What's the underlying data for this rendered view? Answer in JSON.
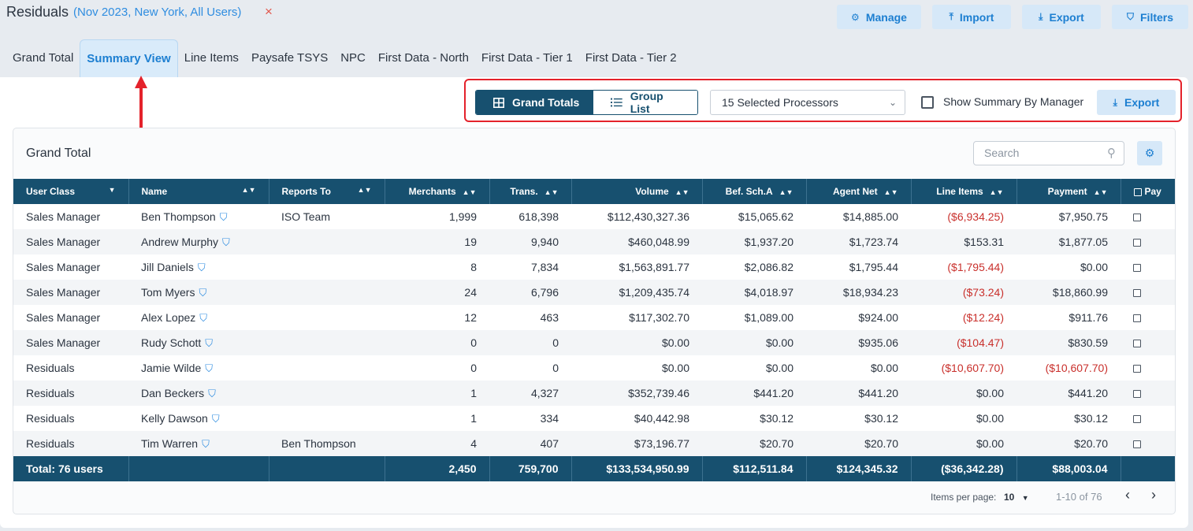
{
  "header": {
    "title": "Residuals",
    "subtitle": "(Nov 2023, New York, All Users)",
    "close_icon": "×",
    "buttons": [
      {
        "icon": "⚙",
        "label": "Manage"
      },
      {
        "icon": "⤒",
        "label": "Import"
      },
      {
        "icon": "⤓",
        "label": "Export"
      },
      {
        "icon": "⛉",
        "label": "Filters"
      }
    ]
  },
  "tabs": [
    {
      "label": "Grand Total",
      "active": false
    },
    {
      "label": "Summary View",
      "active": true
    },
    {
      "label": "Line Items",
      "active": false
    },
    {
      "label": "Paysafe TSYS",
      "active": false
    },
    {
      "label": "NPC",
      "active": false
    },
    {
      "label": "First Data - North",
      "active": false
    },
    {
      "label": "First Data - Tier 1",
      "active": false
    },
    {
      "label": "First Data - Tier 2",
      "active": false
    }
  ],
  "toolbar": {
    "grand_totals_label": "Grand Totals",
    "group_list_label": "Group List",
    "processors_value": "15 Selected Processors",
    "show_summary_label": "Show Summary By Manager",
    "show_summary_checked": false,
    "export_label": "Export"
  },
  "card": {
    "title": "Grand Total",
    "search_placeholder": "Search"
  },
  "table": {
    "columns": [
      "User Class",
      "Name",
      "Reports To",
      "Merchants",
      "Trans.",
      "Volume",
      "Bef. Sch.A",
      "Agent Net",
      "Line Items",
      "Payment",
      "Pay"
    ],
    "rows": [
      {
        "user_class": "Sales Manager",
        "name": "Ben Thompson",
        "reports_to": "ISO Team",
        "merchants": "1,999",
        "trans": "618,398",
        "volume": "$112,430,327.36",
        "bef_sch_a": "$15,065.62",
        "agent_net": "$14,885.00",
        "line_items": "($6,934.25)",
        "payment": "$7,950.75"
      },
      {
        "user_class": "Sales Manager",
        "name": "Andrew Murphy",
        "reports_to": "",
        "merchants": "19",
        "trans": "9,940",
        "volume": "$460,048.99",
        "bef_sch_a": "$1,937.20",
        "agent_net": "$1,723.74",
        "line_items": "$153.31",
        "payment": "$1,877.05"
      },
      {
        "user_class": "Sales Manager",
        "name": "Jill Daniels",
        "reports_to": "",
        "merchants": "8",
        "trans": "7,834",
        "volume": "$1,563,891.77",
        "bef_sch_a": "$2,086.82",
        "agent_net": "$1,795.44",
        "line_items": "($1,795.44)",
        "payment": "$0.00"
      },
      {
        "user_class": "Sales Manager",
        "name": "Tom Myers",
        "reports_to": "",
        "merchants": "24",
        "trans": "6,796",
        "volume": "$1,209,435.74",
        "bef_sch_a": "$4,018.97",
        "agent_net": "$18,934.23",
        "line_items": "($73.24)",
        "payment": "$18,860.99"
      },
      {
        "user_class": "Sales Manager",
        "name": "Alex Lopez",
        "reports_to": "",
        "merchants": "12",
        "trans": "463",
        "volume": "$117,302.70",
        "bef_sch_a": "$1,089.00",
        "agent_net": "$924.00",
        "line_items": "($12.24)",
        "payment": "$911.76"
      },
      {
        "user_class": "Sales Manager",
        "name": "Rudy Schott",
        "reports_to": "",
        "merchants": "0",
        "trans": "0",
        "volume": "$0.00",
        "bef_sch_a": "$0.00",
        "agent_net": "$935.06",
        "line_items": "($104.47)",
        "payment": "$830.59"
      },
      {
        "user_class": "Residuals",
        "name": "Jamie Wilde",
        "reports_to": "",
        "merchants": "0",
        "trans": "0",
        "volume": "$0.00",
        "bef_sch_a": "$0.00",
        "agent_net": "$0.00",
        "line_items": "($10,607.70)",
        "payment": "($10,607.70)"
      },
      {
        "user_class": "Residuals",
        "name": "Dan Beckers",
        "reports_to": "",
        "merchants": "1",
        "trans": "4,327",
        "volume": "$352,739.46",
        "bef_sch_a": "$441.20",
        "agent_net": "$441.20",
        "line_items": "$0.00",
        "payment": "$441.20"
      },
      {
        "user_class": "Residuals",
        "name": "Kelly Dawson",
        "reports_to": "",
        "merchants": "1",
        "trans": "334",
        "volume": "$40,442.98",
        "bef_sch_a": "$30.12",
        "agent_net": "$30.12",
        "line_items": "$0.00",
        "payment": "$30.12"
      },
      {
        "user_class": "Residuals",
        "name": "Tim Warren",
        "reports_to": "Ben Thompson",
        "merchants": "4",
        "trans": "407",
        "volume": "$73,196.77",
        "bef_sch_a": "$20.70",
        "agent_net": "$20.70",
        "line_items": "$0.00",
        "payment": "$20.70"
      }
    ],
    "totals": {
      "label": "Total: 76 users",
      "merchants": "2,450",
      "trans": "759,700",
      "volume": "$133,534,950.99",
      "bef_sch_a": "$112,511.84",
      "agent_net": "$124,345.32",
      "line_items": "($36,342.28)",
      "payment": "$88,003.04"
    }
  },
  "pagination": {
    "items_per_page_label": "Items per page:",
    "items_per_page_value": "10",
    "range_text": "1-10 of 76"
  },
  "colors": {
    "accent": "#1d7fd1",
    "header_dark": "#17506f",
    "negative": "#c9302c",
    "highlight": "#e4222b"
  }
}
